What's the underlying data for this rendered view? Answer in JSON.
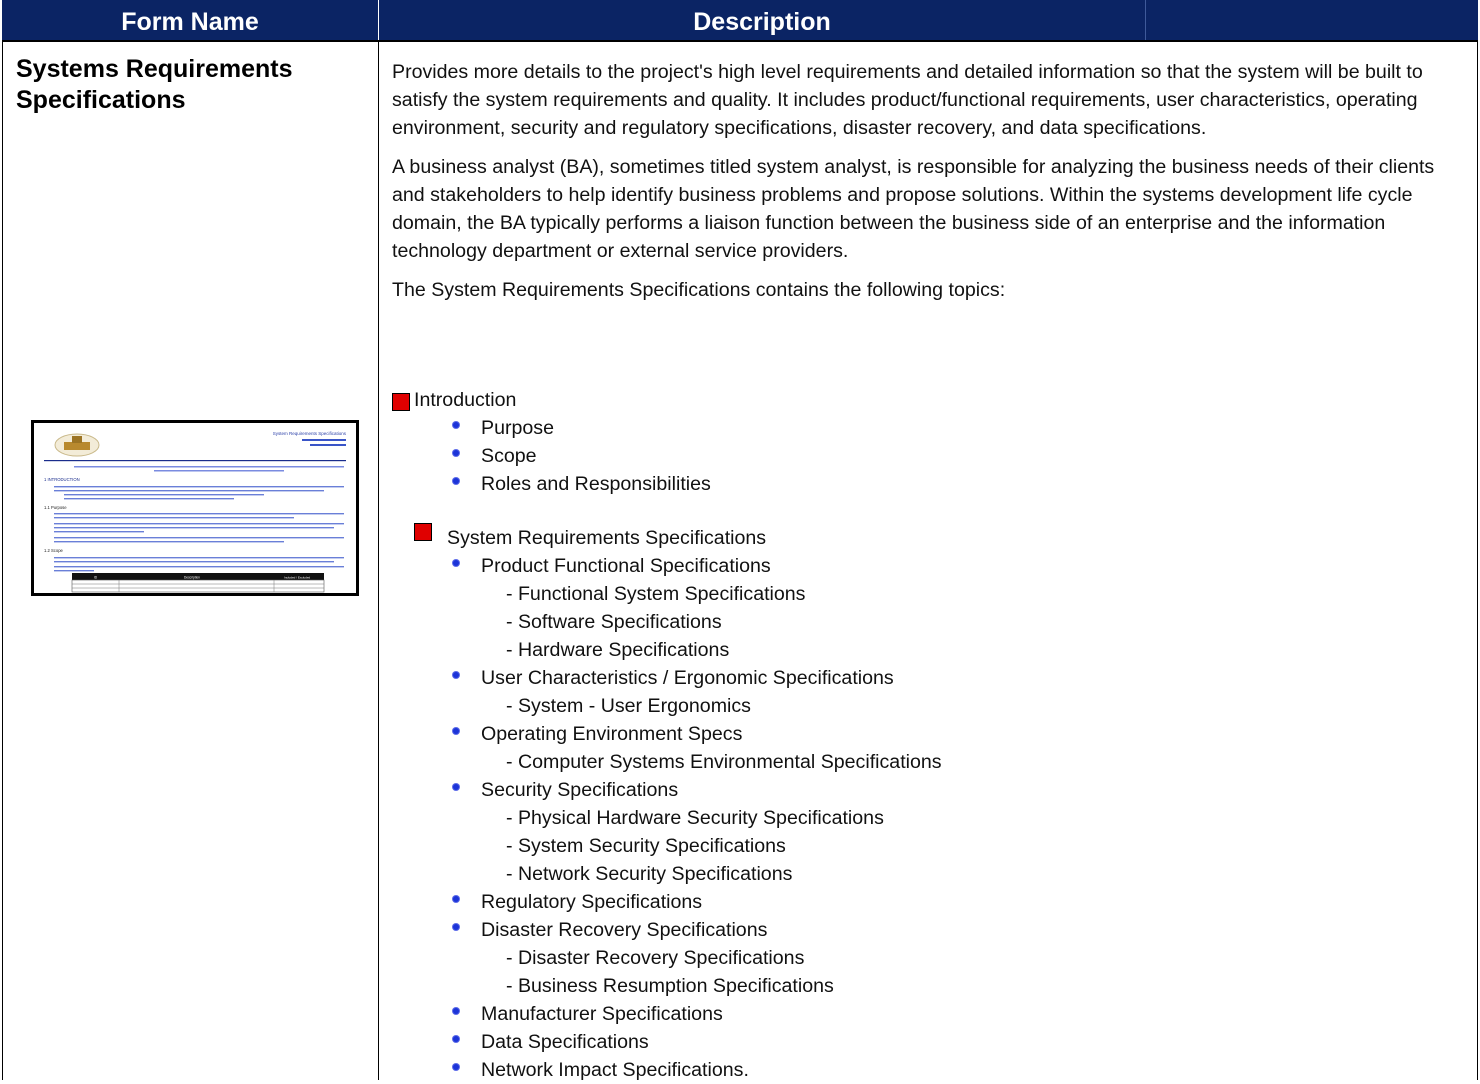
{
  "header": {
    "col1": "Form Name",
    "col2": "Description"
  },
  "form": {
    "title": "Systems Requirements Specifications"
  },
  "description": {
    "p1": "Provides more details to the project's high level requirements and detailed information so that the system will be built to satisfy the system requirements and quality. It includes product/functional requirements, user characteristics, operating environment, security and regulatory specifications, disaster recovery, and data specifications.",
    "p2": "A business analyst (BA), sometimes titled system analyst, is responsible for analyzing the business needs of their clients and stakeholders to help identify business problems and propose solutions. Within the systems development life cycle domain, the BA typically performs a liaison function between the business side of an enterprise and the information technology department or external service providers.",
    "p3": "The System Requirements Specifications contains the following topics:"
  },
  "topics": {
    "intro": "Introduction",
    "intro_items": [
      "Purpose",
      "Scope",
      "Roles and Responsibilities"
    ],
    "srs": "System Requirements Specifications",
    "srs_items": [
      "Product Functional Specifications",
      "- Functional System Specifications",
      "- Software Specifications",
      "- Hardware Specifications",
      "User Characteristics / Ergonomic Specifications",
      "- System - User Ergonomics",
      "Operating Environment Specs",
      "- Computer Systems Environmental Specifications",
      "Security Specifications",
      "- Physical Hardware Security Specifications",
      "- System Security Specifications",
      "- Network Security Specifications",
      "Regulatory Specifications",
      "Disaster Recovery Specifications",
      "- Disaster Recovery Specifications",
      "- Business Resumption Specifications",
      "Manufacturer Specifications",
      "Data Specifications",
      "Network Impact Specifications."
    ]
  },
  "thumbnail": {
    "header_text": "System Requirements Specifications",
    "section1": "1 INTRODUCTION",
    "section11": "1.1 Purpose",
    "section12": "1.2 Scope",
    "table_col1": "ID",
    "table_col2": "Description",
    "table_col3": "Included / Excluded"
  }
}
